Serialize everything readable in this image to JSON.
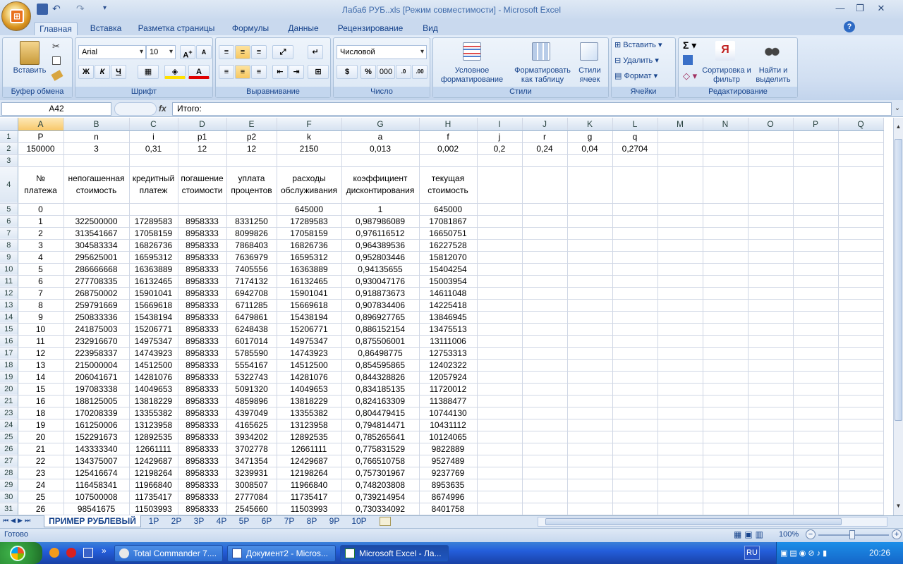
{
  "window": {
    "title": "Лаба6 РУБ..xls  [Режим совместимости] - Microsoft Excel"
  },
  "ribbon_tabs": [
    "Главная",
    "Вставка",
    "Разметка страницы",
    "Формулы",
    "Данные",
    "Рецензирование",
    "Вид"
  ],
  "ribbon": {
    "clipboard": {
      "label": "Буфер обмена",
      "paste": "Вставить"
    },
    "font": {
      "label": "Шрифт",
      "family": "Arial",
      "size": "10",
      "bold": "Ж",
      "italic": "К",
      "underline": "Ч"
    },
    "alignment": {
      "label": "Выравнивание"
    },
    "number": {
      "label": "Число",
      "format": "Числовой",
      "percent": "%",
      "thousands": "000"
    },
    "styles": {
      "label": "Стили",
      "cond_format": "Условное форматирование",
      "as_table": "Форматировать как таблицу",
      "cell_styles": "Стили ячеек"
    },
    "cells": {
      "label": "Ячейки",
      "insert": "Вставить",
      "delete": "Удалить",
      "format": "Формат"
    },
    "editing": {
      "label": "Редактирование",
      "sort": "Сортировка и фильтр",
      "find": "Найти и выделить"
    }
  },
  "formula_bar": {
    "name_box": "A42",
    "fx": "fx",
    "content": "Итого:"
  },
  "columns": [
    "A",
    "B",
    "C",
    "D",
    "E",
    "F",
    "G",
    "H",
    "I",
    "J",
    "K",
    "L",
    "M",
    "N",
    "O",
    "P",
    "Q"
  ],
  "row1": [
    "P",
    "n",
    "i",
    "p1",
    "p2",
    "k",
    "a",
    "f",
    "j",
    "r",
    "g",
    "q"
  ],
  "row2": [
    "150000",
    "3",
    "0,31",
    "12",
    "12",
    "2150",
    "0,013",
    "0,002",
    "0,2",
    "0,24",
    "0,04",
    "0,2704"
  ],
  "row4": [
    "№ платежа",
    "непогашенная стоимость",
    "кредитный платеж",
    "погашение стоимости",
    "уплата процентов",
    "расходы обслуживания",
    "коэффициент дисконтирования",
    "текущая стоимость"
  ],
  "row5": [
    "0",
    "",
    "",
    "",
    "",
    "645000",
    "1",
    "645000"
  ],
  "data_rows": [
    {
      "r": "6",
      "v": [
        "1",
        "322500000",
        "17289583",
        "8958333",
        "8331250",
        "17289583",
        "0,987986089",
        "17081867"
      ]
    },
    {
      "r": "7",
      "v": [
        "2",
        "313541667",
        "17058159",
        "8958333",
        "8099826",
        "17058159",
        "0,976116512",
        "16650751"
      ]
    },
    {
      "r": "8",
      "v": [
        "3",
        "304583334",
        "16826736",
        "8958333",
        "7868403",
        "16826736",
        "0,964389536",
        "16227528"
      ]
    },
    {
      "r": "9",
      "v": [
        "4",
        "295625001",
        "16595312",
        "8958333",
        "7636979",
        "16595312",
        "0,952803446",
        "15812070"
      ]
    },
    {
      "r": "10",
      "v": [
        "5",
        "286666668",
        "16363889",
        "8958333",
        "7405556",
        "16363889",
        "0,94135655",
        "15404254"
      ]
    },
    {
      "r": "11",
      "v": [
        "6",
        "277708335",
        "16132465",
        "8958333",
        "7174132",
        "16132465",
        "0,930047176",
        "15003954"
      ]
    },
    {
      "r": "12",
      "v": [
        "7",
        "268750002",
        "15901041",
        "8958333",
        "6942708",
        "15901041",
        "0,918873673",
        "14611048"
      ]
    },
    {
      "r": "13",
      "v": [
        "8",
        "259791669",
        "15669618",
        "8958333",
        "6711285",
        "15669618",
        "0,907834406",
        "14225418"
      ]
    },
    {
      "r": "14",
      "v": [
        "9",
        "250833336",
        "15438194",
        "8958333",
        "6479861",
        "15438194",
        "0,896927765",
        "13846945"
      ]
    },
    {
      "r": "15",
      "v": [
        "10",
        "241875003",
        "15206771",
        "8958333",
        "6248438",
        "15206771",
        "0,886152154",
        "13475513"
      ]
    },
    {
      "r": "16",
      "v": [
        "11",
        "232916670",
        "14975347",
        "8958333",
        "6017014",
        "14975347",
        "0,875506001",
        "13111006"
      ]
    },
    {
      "r": "17",
      "v": [
        "12",
        "223958337",
        "14743923",
        "8958333",
        "5785590",
        "14743923",
        "0,86498775",
        "12753313"
      ]
    },
    {
      "r": "18",
      "v": [
        "13",
        "215000004",
        "14512500",
        "8958333",
        "5554167",
        "14512500",
        "0,854595865",
        "12402322"
      ]
    },
    {
      "r": "19",
      "v": [
        "14",
        "206041671",
        "14281076",
        "8958333",
        "5322743",
        "14281076",
        "0,844328826",
        "12057924"
      ]
    },
    {
      "r": "20",
      "v": [
        "15",
        "197083338",
        "14049653",
        "8958333",
        "5091320",
        "14049653",
        "0,834185135",
        "11720012"
      ]
    },
    {
      "r": "21",
      "v": [
        "16",
        "188125005",
        "13818229",
        "8958333",
        "4859896",
        "13818229",
        "0,824163309",
        "11388477"
      ]
    },
    {
      "r": "23",
      "v": [
        "18",
        "170208339",
        "13355382",
        "8958333",
        "4397049",
        "13355382",
        "0,804479415",
        "10744130"
      ]
    },
    {
      "r": "24",
      "v": [
        "19",
        "161250006",
        "13123958",
        "8958333",
        "4165625",
        "13123958",
        "0,794814471",
        "10431112"
      ]
    },
    {
      "r": "25",
      "v": [
        "20",
        "152291673",
        "12892535",
        "8958333",
        "3934202",
        "12892535",
        "0,785265641",
        "10124065"
      ]
    },
    {
      "r": "26",
      "v": [
        "21",
        "143333340",
        "12661111",
        "8958333",
        "3702778",
        "12661111",
        "0,775831529",
        "9822889"
      ]
    },
    {
      "r": "27",
      "v": [
        "22",
        "134375007",
        "12429687",
        "8958333",
        "3471354",
        "12429687",
        "0,766510758",
        "9527489"
      ]
    },
    {
      "r": "28",
      "v": [
        "23",
        "125416674",
        "12198264",
        "8958333",
        "3239931",
        "12198264",
        "0,757301967",
        "9237769"
      ]
    },
    {
      "r": "29",
      "v": [
        "24",
        "116458341",
        "11966840",
        "8958333",
        "3008507",
        "11966840",
        "0,748203808",
        "8953635"
      ]
    },
    {
      "r": "30",
      "v": [
        "25",
        "107500008",
        "11735417",
        "8958333",
        "2777084",
        "11735417",
        "0,739214954",
        "8674996"
      ]
    },
    {
      "r": "31",
      "v": [
        "26",
        "98541675",
        "11503993",
        "8958333",
        "2545660",
        "11503993",
        "0,730334092",
        "8401758"
      ]
    }
  ],
  "sheet_tabs": [
    "ПРИМЕР РУБЛЕВЫЙ",
    "1Р",
    "2Р",
    "3Р",
    "4Р",
    "5Р",
    "6Р",
    "7Р",
    "8Р",
    "9Р",
    "10Р"
  ],
  "status": {
    "ready": "Готово",
    "zoom": "100%"
  },
  "taskbar": {
    "tasks": [
      "Total Commander 7....",
      "Документ2 - Micros...",
      "Microsoft Excel - Ла..."
    ],
    "lang": "RU",
    "clock": "20:26"
  }
}
